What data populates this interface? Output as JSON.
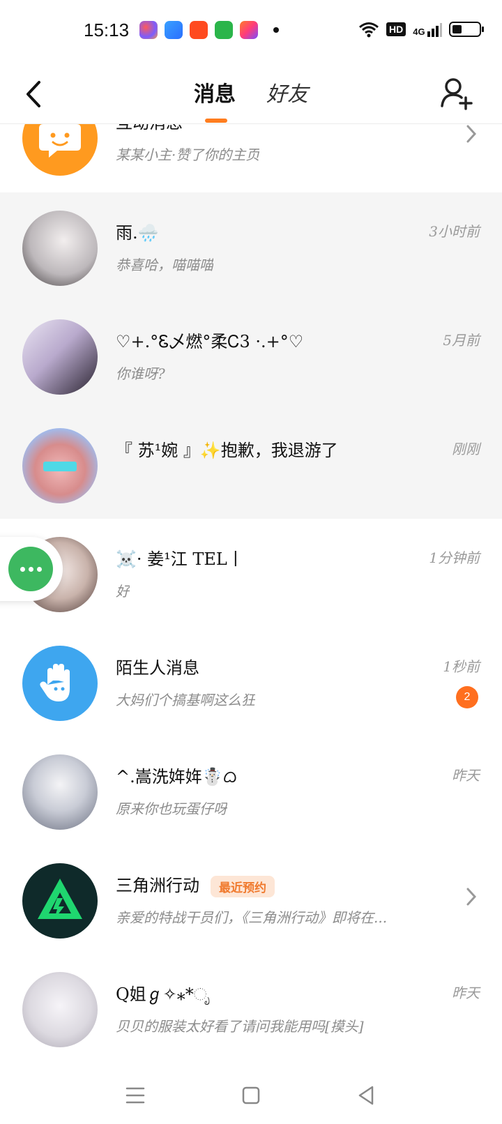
{
  "status_bar": {
    "time": "15:13",
    "hd_label": "HD",
    "network_label": "4G",
    "battery_level": 0.35,
    "notification_icons": [
      "palette-app-icon",
      "blue-app-icon",
      "red-app-icon",
      "green-store-icon",
      "orange-app-icon"
    ]
  },
  "header": {
    "back_icon": "chevron-left-icon",
    "tabs": [
      {
        "label": "消息",
        "active": true
      },
      {
        "label": "好友",
        "active": false
      }
    ],
    "add_friend_icon": "add-user-icon",
    "accent_color": "#ff7d1f"
  },
  "conversations": [
    {
      "name": "互动消息",
      "preview": "某某小主·赞了你的主页",
      "time": "",
      "avatar_color": "#ff9a1f",
      "has_chevron": true,
      "pinned": false
    },
    {
      "name": "雨.🌧️",
      "preview": "恭喜哈，喵喵喵",
      "time": "3小时前",
      "avatar_color": "#cfcfd4",
      "pinned": true
    },
    {
      "name": "♡+.°Ꮛ乄燃°柔Ꮯ3 ·.+°♡",
      "preview": "你谁呀?",
      "time": "5月前",
      "avatar_color": "#d6cfe6",
      "pinned": true
    },
    {
      "name": "『 苏¹婉 』✨抱歉，我退游了",
      "preview": "",
      "time": "刚刚",
      "avatar_color": "#a9c3ef",
      "pinned": true
    },
    {
      "name": "☠️· 姜¹江 TEL丨",
      "preview": "好",
      "time": "1分钟前",
      "avatar_color": "#b9a9a3",
      "pinned": false
    },
    {
      "name": "陌生人消息",
      "preview": "大妈们个搞基啊这么狂",
      "time": "1秒前",
      "avatar_color": "#3ea6ef",
      "badge": "2",
      "pinned": false
    },
    {
      "name": "^.嵩洗姩姩☃️ᜊ",
      "preview": "原来你也玩蛋仔呀",
      "time": "昨天",
      "avatar_color": "#c8ccd6",
      "pinned": false
    },
    {
      "name": "三角洲行动",
      "tag": "最近预约",
      "preview": "亲爱的特战干员们，《三角洲行动》即将在...",
      "time": "",
      "avatar_color": "#0f2a2a",
      "has_chevron": true,
      "pinned": false
    },
    {
      "name": "Q姐ℊ✧⁎*ೃ",
      "preview": "贝贝的服装太好看了请问我能用吗[摸头]",
      "time": "昨天",
      "avatar_color": "#dcd9e0",
      "pinned": false
    }
  ],
  "floating_button": {
    "icon": "more-dots-icon",
    "color": "#3db860"
  },
  "navbar": {
    "icons": [
      "menu-icon",
      "home-square-icon",
      "back-triangle-icon"
    ]
  }
}
